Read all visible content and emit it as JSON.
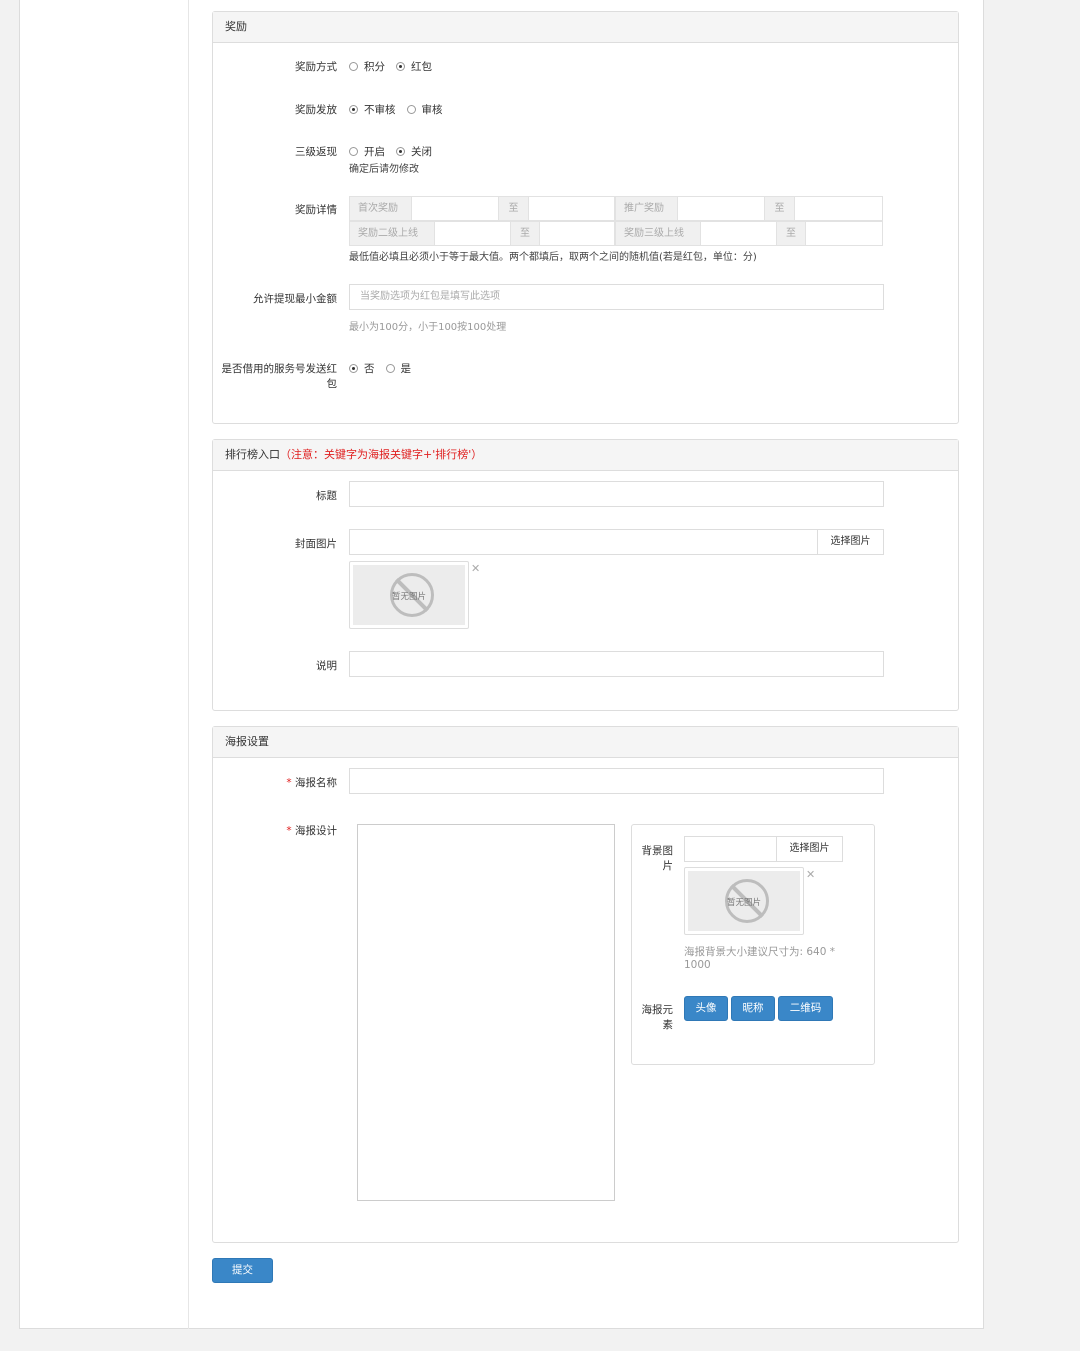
{
  "reward": {
    "title": "奖励",
    "method": {
      "label": "奖励方式",
      "options": [
        "积分",
        "红包"
      ],
      "selected": 1
    },
    "issue": {
      "label": "奖励发放",
      "options": [
        "不审核",
        "审核"
      ],
      "selected": 0
    },
    "three_level": {
      "label": "三级返现",
      "options": [
        "开启",
        "关闭"
      ],
      "selected": 1,
      "help": "确定后请勿修改"
    },
    "details": {
      "label": "奖励详情",
      "first_reward": "首次奖励",
      "promo_reward": "推广奖励",
      "level2_online": "奖励二级上线",
      "level3_online": "奖励三级上线",
      "to": "至",
      "help": "最低值必填且必须小于等于最大值。两个都填后，取两个之间的随机值(若是红包，单位：分)"
    },
    "min_withdraw": {
      "label": "允许提现最小金额",
      "placeholder": "当奖励选项为红包是填写此选项",
      "help": "最小为100分，小于100按100处理"
    },
    "borrow_service": {
      "label_line1": "是否借用的服务号发送红",
      "label_line2": "包",
      "options": [
        "否",
        "是"
      ],
      "selected": 0
    }
  },
  "ranking": {
    "title": "排行榜入口",
    "note": "（注意：关键字为海报关键字+'排行榜'）",
    "title_field": {
      "label": "标题",
      "value": ""
    },
    "cover": {
      "label": "封面图片",
      "button": "选择图片",
      "no_image": "暂无图片",
      "remove": "✕"
    },
    "desc": {
      "label": "说明",
      "value": ""
    }
  },
  "poster": {
    "title": "海报设置",
    "required_mark": "*",
    "name": {
      "label": "海报名称",
      "value": ""
    },
    "design": {
      "label": "海报设计",
      "bg_label_line1": "背景图",
      "bg_label_line2": "片",
      "bg_button": "选择图片",
      "no_image": "暂无图片",
      "remove": "✕",
      "bg_help_line1": "海报背景大小建议尺寸为: 640 *",
      "bg_help_line2": "1000",
      "elements_label_line1": "海报元",
      "elements_label_line2": "素",
      "elements": [
        "头像",
        "昵称",
        "二维码"
      ]
    }
  },
  "submit": "提交",
  "colors": {
    "primary": "#3a87c8",
    "required": "#e02020"
  }
}
